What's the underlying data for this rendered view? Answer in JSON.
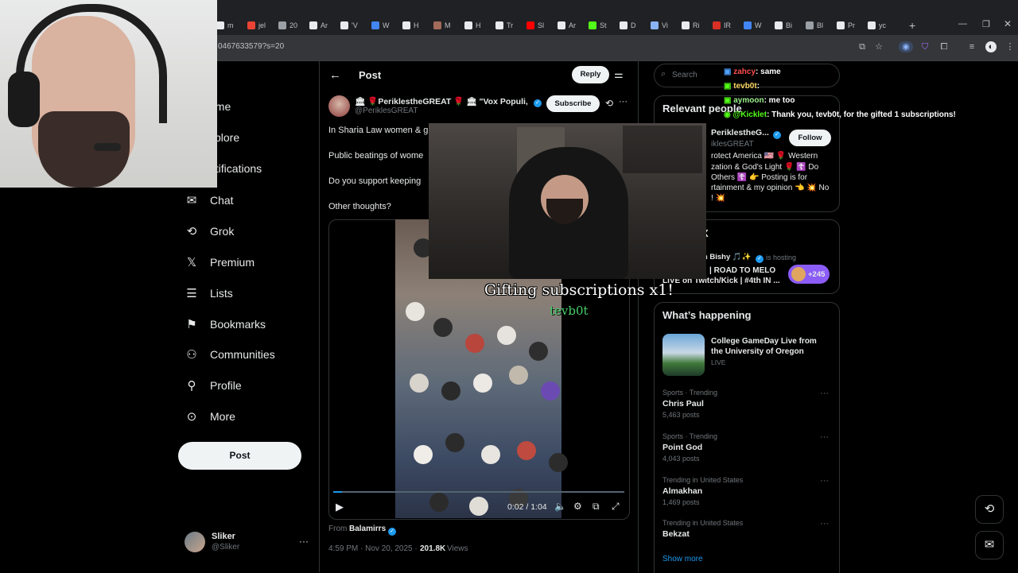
{
  "browser": {
    "tabs": [
      "m",
      "jel",
      "20",
      "Ar",
      "'V",
      "W",
      "H",
      "M",
      "H",
      "Tr",
      "Sl",
      "Ar",
      "St",
      "D",
      "Vi",
      "Ri",
      "IR",
      "W",
      "Bi",
      "Bl",
      "Pr",
      "yc"
    ],
    "url": "0467633579?s=20",
    "new_tab": "+"
  },
  "nav": {
    "items": [
      {
        "label": "ome",
        "icon": "home-icon"
      },
      {
        "label": "xplore",
        "icon": "search-icon"
      },
      {
        "label": "otifications",
        "icon": "bell-icon"
      },
      {
        "label": "Chat",
        "icon": "chat-icon"
      },
      {
        "label": "Grok",
        "icon": "grok-icon"
      },
      {
        "label": "Premium",
        "icon": "x-logo-icon"
      },
      {
        "label": "Lists",
        "icon": "list-icon"
      },
      {
        "label": "Bookmarks",
        "icon": "bookmark-icon"
      },
      {
        "label": "Communities",
        "icon": "communities-icon"
      },
      {
        "label": "Profile",
        "icon": "profile-icon"
      },
      {
        "label": "More",
        "icon": "more-icon"
      }
    ],
    "post_label": "Post",
    "account": {
      "name": "Sliker",
      "handle": "@Sliker"
    }
  },
  "post": {
    "header_title": "Post",
    "reply_label": "Reply",
    "author_name": "🏛 🌹PeriklestheGREAT 🌹 🏛 \"Vox Populi, ...",
    "author_handle": "@PeriklesGREAT",
    "subscribe_label": "Subscribe",
    "lines": [
      "In Sharia Law women & g",
      "Public beatings of wome",
      "Do you support keeping",
      "Other thoughts?"
    ],
    "video_time": "0:02 / 1:04",
    "video_progress": 0.03,
    "from_label": "From",
    "from_account": "Balamirrs",
    "timestamp": "4:59 PM · Nov 20, 2025 ·",
    "views_count": "201.8K",
    "views_label": "Views"
  },
  "stream_overlay": {
    "gift_text": "Gifting subscriptions x1!",
    "gift_user": "tevb0t"
  },
  "chat": [
    {
      "user": "zahcy",
      "msg": ": same",
      "color": "#ff4d4d"
    },
    {
      "user": "tevb0t",
      "msg": ": ",
      "color": "#ffd966"
    },
    {
      "user": "aymoon",
      "msg": ": me too",
      "color": "#9cf28c"
    },
    {
      "user": "@Kicklet",
      "msg": ": Thank you, tevb0t, for the gifted 1 subscriptions!",
      "color": "#53fc18"
    }
  ],
  "sidebar": {
    "search_placeholder": "Search",
    "relevant_title": "Relevant people",
    "relevant_name": "PeriklestheG...",
    "relevant_handle": "iklesGREAT",
    "follow_label": "Follow",
    "bio_lines": [
      "rotect America 🇺🇸 🌹 Western",
      "zation & God's Light 🌹 ☦️ Do",
      "Others ☦️ 👉 Posting is for",
      "rtainment & my opinion 👈 💥 No",
      "! 💥"
    ],
    "spaces_heading": "X",
    "spaces_host": "am Bishy 🎵✨",
    "spaces_hosting": "is hosting",
    "spaces_title_1": "| ROAD TO MELO",
    "spaces_title_2": "LIVE on Twitch/Kick | #4th IN ...",
    "spaces_listeners": "+245",
    "happening_title": "What’s happening",
    "live_event": {
      "title": "College GameDay Live from the University of Oregon",
      "status": "LIVE"
    },
    "trends": [
      {
        "context": "Sports · Trending",
        "name": "Chris Paul",
        "posts": "5,463 posts"
      },
      {
        "context": "Sports · Trending",
        "name": "Point God",
        "posts": "4,043 posts"
      },
      {
        "context": "Trending in United States",
        "name": "Almakhan",
        "posts": "1,469 posts"
      },
      {
        "context": "Trending in United States",
        "name": "Bekzat",
        "posts": ""
      }
    ],
    "show_more": "Show more"
  }
}
